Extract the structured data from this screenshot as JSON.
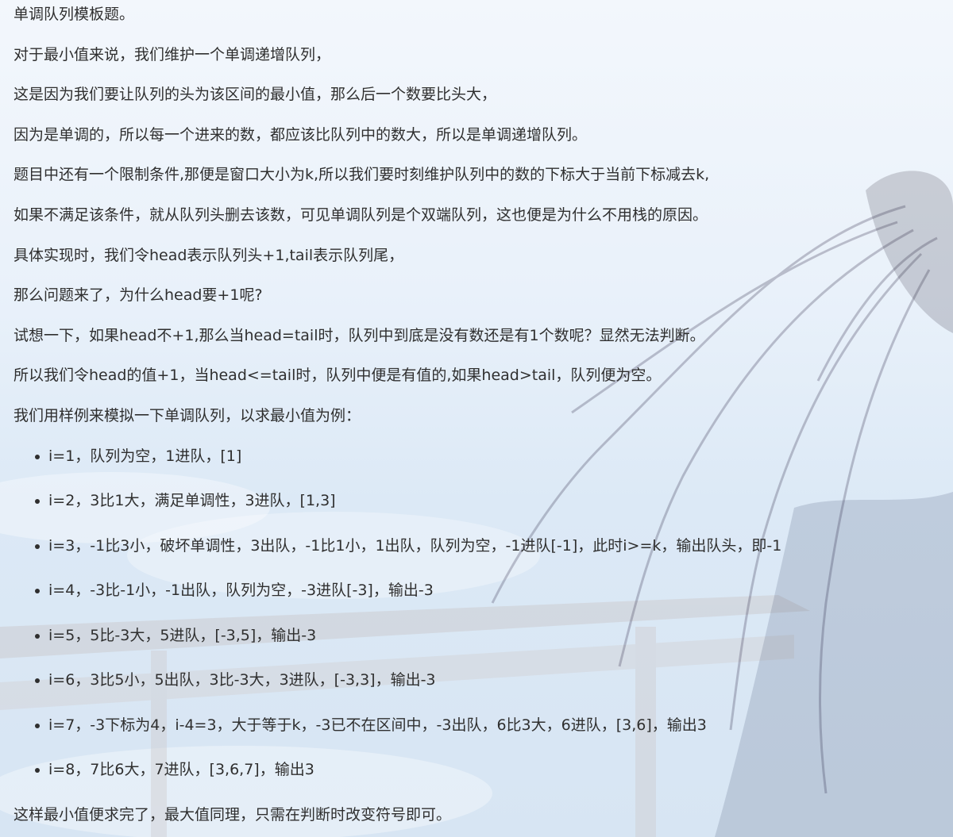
{
  "intro": [
    "单调队列模板题。",
    "对于最小值来说，我们维护一个单调递增队列，",
    "这是因为我们要让队列的头为该区间的最小值，那么后一个数要比头大，",
    "因为是单调的，所以每一个进来的数，都应该比队列中的数大，所以是单调递增队列。",
    "题目中还有一个限制条件,那便是窗口大小为k,所以我们要时刻维护队列中的数的下标大于当前下标减去k,",
    "如果不满足该条件，就从队列头删去该数，可见单调队列是个双端队列，这也便是为什么不用栈的原因。",
    "具体实现时，我们令head表示队列头+1,tail表示队列尾，",
    "那么问题来了，为什么head要+1呢?",
    "试想一下，如果head不+1,那么当head=tail时，队列中到底是没有数还是有1个数呢？显然无法判断。",
    "所以我们令head的值+1，当head<=tail时，队列中便是有值的,如果head>tail，队列便为空。",
    "我们用样例来模拟一下单调队列，以求最小值为例："
  ],
  "steps": [
    "i=1，队列为空，1进队，[1]",
    "i=2，3比1大，满足单调性，3进队，[1,3]",
    "i=3，-1比3小，破坏单调性，3出队，-1比1小，1出队，队列为空，-1进队[-1]，此时i>=k，输出队头，即-1",
    "i=4，-3比-1小，-1出队，队列为空，-3进队[-3]，输出-3",
    "i=5，5比-3大，5进队，[-3,5]，输出-3",
    "i=6，3比5小，5出队，3比-3大，3进队，[-3,3]，输出-3",
    "i=7，-3下标为4，i-4=3，大于等于k，-3已不在区间中，-3出队，6比3大，6进队，[3,6]，输出3",
    "i=8，7比6大，7进队，[3,6,7]，输出3"
  ],
  "closing": "这样最小值便求完了，最大值同理，只需在判断时改变符号即可。"
}
